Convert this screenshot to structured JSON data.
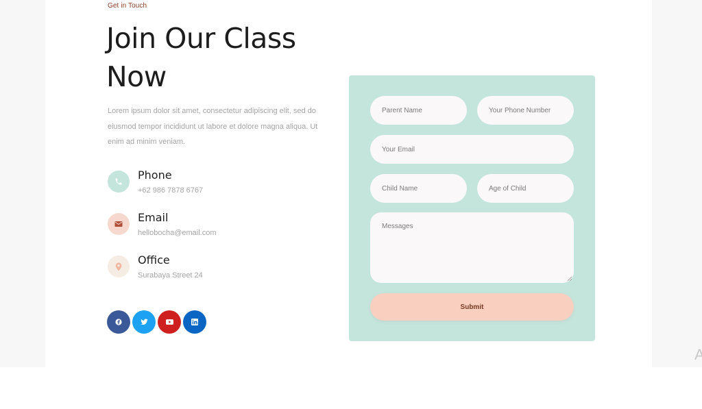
{
  "section": {
    "eyebrow": "Get in Touch",
    "title": "Join Our Class Now",
    "description": "Lorem ipsum dolor sit amet, consectetur adipiscing elit, sed do eiusmod tempor incididunt ut labore et dolore magna aliqua. Ut enim ad minim veniam."
  },
  "contacts": [
    {
      "title": "Phone",
      "value": "+62 986 7878 6767",
      "icon": "phone-icon",
      "color": "#c4e5dc",
      "icon_color": "#ffffff"
    },
    {
      "title": "Email",
      "value": "hellobocha@email.com",
      "icon": "envelope-icon",
      "color": "#f7d8cf",
      "icon_color": "#b0503a"
    },
    {
      "title": "Office",
      "value": "Surabaya Street 24",
      "icon": "location-pin-icon",
      "color": "#f5ece3",
      "icon_color": "#f0b7a0"
    }
  ],
  "socials": [
    {
      "name": "facebook",
      "icon": "facebook-icon",
      "color": "#3b5998"
    },
    {
      "name": "twitter",
      "icon": "twitter-icon",
      "color": "#1da1f2"
    },
    {
      "name": "youtube",
      "icon": "youtube-icon",
      "color": "#cd201f"
    },
    {
      "name": "linkedin",
      "icon": "linkedin-icon",
      "color": "#0a66c2"
    }
  ],
  "form": {
    "parent_name_placeholder": "Parent Name",
    "phone_placeholder": "Your Phone Number",
    "email_placeholder": "Your Email",
    "child_name_placeholder": "Child Name",
    "age_placeholder": "Age of Child",
    "messages_placeholder": "Messages",
    "submit_label": "Submit",
    "card_color": "#c4e5dc",
    "submit_color": "#f9cfc0"
  },
  "edge_text": "A"
}
